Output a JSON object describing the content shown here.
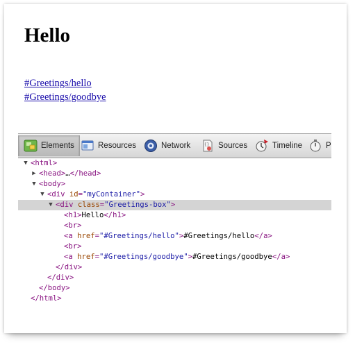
{
  "page": {
    "heading": "Hello",
    "links": [
      "#Greetings/hello",
      "#Greetings/goodbye"
    ]
  },
  "devtools": {
    "tabs": [
      {
        "label": "Elements",
        "icon": "elements-icon",
        "active": true
      },
      {
        "label": "Resources",
        "icon": "resources-icon",
        "active": false
      },
      {
        "label": "Network",
        "icon": "network-icon",
        "active": false
      },
      {
        "label": "Sources",
        "icon": "sources-icon",
        "active": false
      },
      {
        "label": "Timeline",
        "icon": "timeline-icon",
        "active": false
      },
      {
        "label": "P",
        "icon": "profiles-icon",
        "active": false
      }
    ],
    "dom_lines": [
      {
        "indent": 0,
        "toggle": "open",
        "parts": [
          [
            "tag",
            "<html>"
          ]
        ]
      },
      {
        "indent": 1,
        "toggle": "closed",
        "parts": [
          [
            "tag",
            "<head>"
          ],
          [
            "txt",
            "…"
          ],
          [
            "tag",
            "</head>"
          ]
        ]
      },
      {
        "indent": 1,
        "toggle": "open",
        "parts": [
          [
            "tag",
            "<body>"
          ]
        ]
      },
      {
        "indent": 2,
        "toggle": "open",
        "parts": [
          [
            "tag",
            "<div "
          ],
          [
            "attr",
            "id"
          ],
          [
            "tag",
            "="
          ],
          [
            "val",
            "\"myContainer\""
          ],
          [
            "tag",
            ">"
          ]
        ]
      },
      {
        "indent": 3,
        "toggle": "open",
        "selected": true,
        "parts": [
          [
            "tag",
            "<div "
          ],
          [
            "attr",
            "class"
          ],
          [
            "tag",
            "="
          ],
          [
            "val",
            "\"Greetings-box\""
          ],
          [
            "tag",
            ">"
          ]
        ]
      },
      {
        "indent": 4,
        "parts": [
          [
            "tag",
            "<h1>"
          ],
          [
            "txt",
            "Hello"
          ],
          [
            "tag",
            "</h1>"
          ]
        ]
      },
      {
        "indent": 4,
        "parts": [
          [
            "tag",
            "<br>"
          ]
        ]
      },
      {
        "indent": 4,
        "parts": [
          [
            "tag",
            "<a "
          ],
          [
            "attr",
            "href"
          ],
          [
            "tag",
            "="
          ],
          [
            "val",
            "\"#Greetings/hello\""
          ],
          [
            "tag",
            ">"
          ],
          [
            "txt",
            "#Greetings/hello"
          ],
          [
            "tag",
            "</a>"
          ]
        ]
      },
      {
        "indent": 4,
        "parts": [
          [
            "tag",
            "<br>"
          ]
        ]
      },
      {
        "indent": 4,
        "parts": [
          [
            "tag",
            "<a "
          ],
          [
            "attr",
            "href"
          ],
          [
            "tag",
            "="
          ],
          [
            "val",
            "\"#Greetings/goodbye\""
          ],
          [
            "tag",
            ">"
          ],
          [
            "txt",
            "#Greetings/goodbye"
          ],
          [
            "tag",
            "</a>"
          ]
        ]
      },
      {
        "indent": 3,
        "parts": [
          [
            "tag",
            "</div>"
          ]
        ]
      },
      {
        "indent": 2,
        "parts": [
          [
            "tag",
            "</div>"
          ]
        ]
      },
      {
        "indent": 1,
        "parts": [
          [
            "tag",
            "</body>"
          ]
        ]
      },
      {
        "indent": 0,
        "parts": [
          [
            "tag",
            "</html>"
          ]
        ]
      }
    ]
  }
}
